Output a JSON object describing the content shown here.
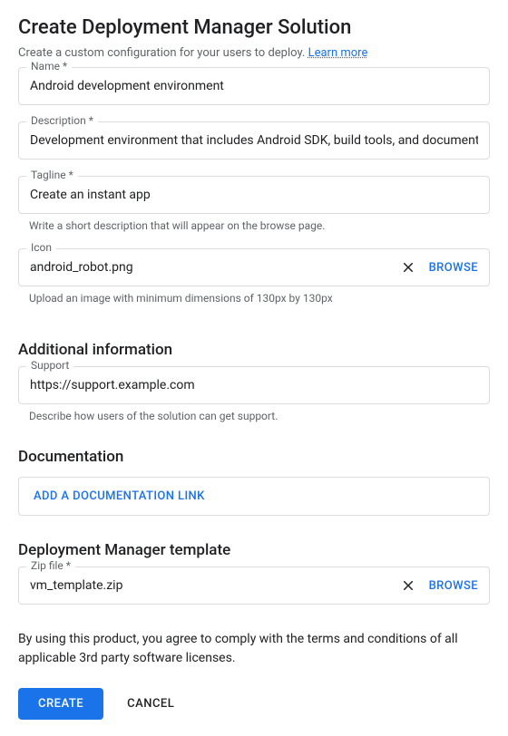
{
  "page_title": "Create Deployment Manager Solution",
  "intro_text": "Create a custom configuration for your users to deploy. ",
  "learn_more_label": "Learn more",
  "fields": {
    "name": {
      "label": "Name *",
      "value": "Android development environment"
    },
    "description": {
      "label": "Description *",
      "value": "Development environment that includes Android SDK, build tools, and documentation."
    },
    "tagline": {
      "label": "Tagline *",
      "value": "Create an instant app",
      "helper": "Write a short description that will appear on the browse page."
    },
    "icon": {
      "label": "Icon",
      "value": "android_robot.png",
      "browse": "BROWSE",
      "helper": "Upload an image with minimum dimensions of 130px by 130px"
    }
  },
  "sections": {
    "additional_info": {
      "heading": "Additional information",
      "support": {
        "label": "Support",
        "value": "https://support.example.com",
        "helper": "Describe how users of the solution can get support."
      }
    },
    "documentation": {
      "heading": "Documentation",
      "add_link_label": "ADD A DOCUMENTATION LINK"
    },
    "template": {
      "heading": "Deployment Manager template",
      "zip": {
        "label": "Zip file *",
        "value": "vm_template.zip",
        "browse": "BROWSE"
      }
    }
  },
  "terms_text": "By using this product, you agree to comply with the terms and conditions of all applicable 3rd party software licenses.",
  "buttons": {
    "create": "CREATE",
    "cancel": "CANCEL"
  }
}
